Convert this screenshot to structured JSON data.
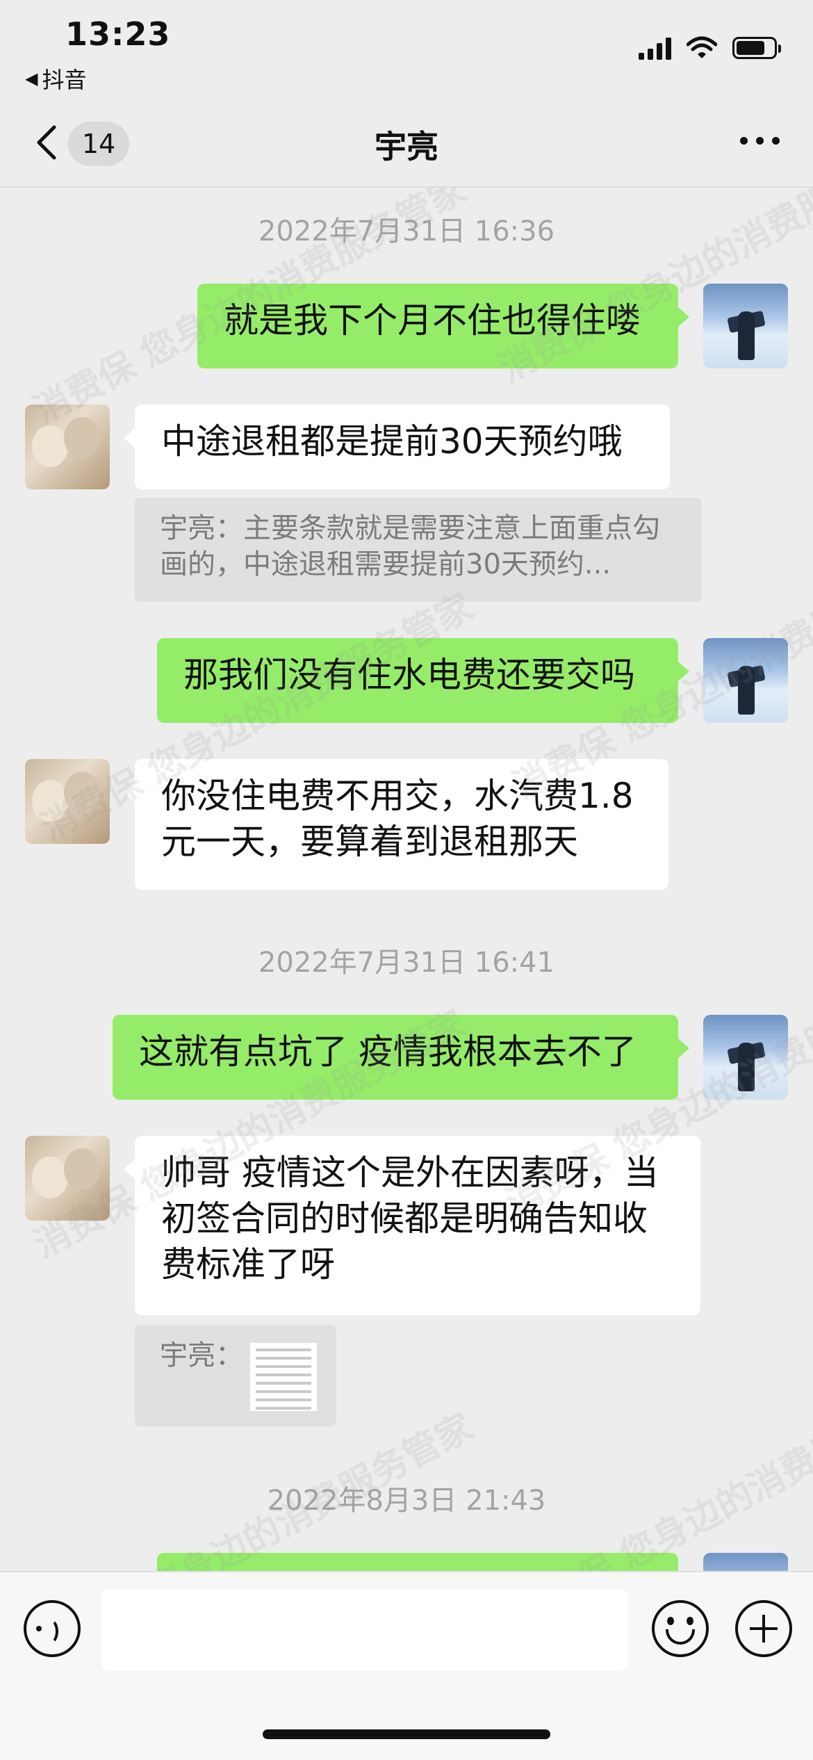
{
  "status": {
    "time": "13:23",
    "back_app": "抖音",
    "back_glyph": "◀"
  },
  "nav": {
    "badge": "14",
    "title": "宇亮"
  },
  "chat": {
    "stamp1": "2022年7月31日 16:36",
    "msg1": "就是我下个月不住也得住喽",
    "msg2": "中途退租都是提前30天预约哦",
    "quote1": "宇亮：主要条款就是需要注意上面重点勾画的，中途退租需要提前30天预约...",
    "msg3": "那我们没有住水电费还要交吗",
    "msg4": "你没住电费不用交，水汽费1.8元一天，要算着到退租那天",
    "stamp2": "2022年7月31日 16:41",
    "msg5": "这就有点坑了 疫情我根本去不了",
    "msg6": "帅哥 疫情这个是外在因素呀，当初签合同的时候都是明确告知收费标准了呀",
    "quote2": "宇亮：",
    "stamp3": "2022年8月3日 21:43"
  },
  "watermark": {
    "text": "消费保 您身边的消费服务管家",
    "color": "#969696"
  },
  "colors": {
    "my_bubble": "#95ec69",
    "other_bubble": "#ffffff",
    "background": "#ededed"
  },
  "icons": {
    "back": "chevron-left-icon",
    "more": "ellipsis-icon",
    "voice": "voice-icon",
    "emoji": "emoji-icon",
    "plus": "plus-icon"
  }
}
